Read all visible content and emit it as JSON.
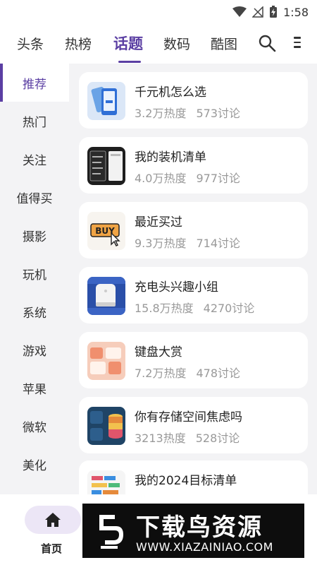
{
  "status_bar": {
    "time": "1:58"
  },
  "top_tabs": [
    {
      "label": "头条"
    },
    {
      "label": "热榜"
    },
    {
      "label": "话题",
      "active": true
    },
    {
      "label": "数码"
    },
    {
      "label": "酷图"
    }
  ],
  "sidebar": {
    "items": [
      {
        "label": "推荐",
        "active": true
      },
      {
        "label": "热门"
      },
      {
        "label": "关注"
      },
      {
        "label": "值得买"
      },
      {
        "label": "摄影"
      },
      {
        "label": "玩机"
      },
      {
        "label": "系统"
      },
      {
        "label": "游戏"
      },
      {
        "label": "苹果"
      },
      {
        "label": "微软"
      },
      {
        "label": "美化"
      }
    ]
  },
  "topics": [
    {
      "title": "千元机怎么选",
      "heat": "3.2万热度",
      "comments": "573讨论",
      "icon": "phone-icon"
    },
    {
      "title": "我的装机清单",
      "heat": "4.0万热度",
      "comments": "977讨论",
      "icon": "pc-build-icon"
    },
    {
      "title": "最近买过",
      "heat": "9.3万热度",
      "comments": "714讨论",
      "icon": "buy-icon"
    },
    {
      "title": "充电头兴趣小组",
      "heat": "15.8万热度",
      "comments": "4270讨论",
      "icon": "charger-icon"
    },
    {
      "title": "键盘大赏",
      "heat": "7.2万热度",
      "comments": "478讨论",
      "icon": "keyboard-icon"
    },
    {
      "title": "你有存储空间焦虑吗",
      "heat": "3213热度",
      "comments": "528讨论",
      "icon": "storage-icon"
    },
    {
      "title": "我的2024目标清单",
      "heat": "",
      "comments": "",
      "icon": "goals-icon"
    }
  ],
  "bottom_nav": {
    "home_label": "首页"
  },
  "watermark": {
    "title": "下载鸟资源",
    "url": "WWW.XIAZAINIAO.COM"
  },
  "colors": {
    "accent": "#5b3fa3",
    "background": "#f3f3f5",
    "muted_text": "#999999"
  }
}
